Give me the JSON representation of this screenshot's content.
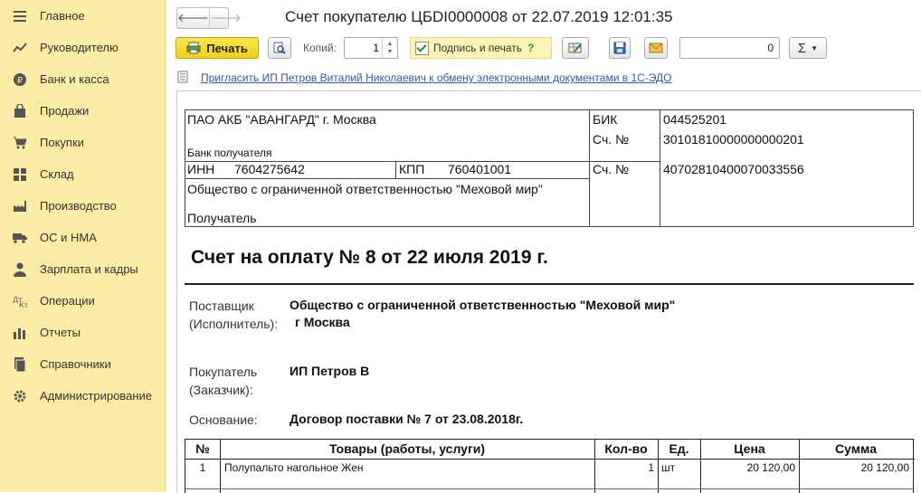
{
  "sidebar": {
    "items": [
      {
        "label": "Главное",
        "icon": "hamburger-icon"
      },
      {
        "label": "Руководителю",
        "icon": "chart-line-icon"
      },
      {
        "label": "Банк и касса",
        "icon": "ruble-icon"
      },
      {
        "label": "Продажи",
        "icon": "shopping-bag-icon"
      },
      {
        "label": "Покупки",
        "icon": "cart-icon"
      },
      {
        "label": "Склад",
        "icon": "warehouse-grid-icon"
      },
      {
        "label": "Производство",
        "icon": "factory-icon"
      },
      {
        "label": "ОС и НМА",
        "icon": "truck-icon"
      },
      {
        "label": "Зарплата и кадры",
        "icon": "person-icon"
      },
      {
        "label": "Операции",
        "icon": "debit-credit-icon"
      },
      {
        "label": "Отчеты",
        "icon": "bar-chart-icon"
      },
      {
        "label": "Справочники",
        "icon": "books-icon"
      },
      {
        "label": "Администрирование",
        "icon": "gear-icon"
      }
    ]
  },
  "header": {
    "back": "🡐",
    "forward": "🡒",
    "title": "Счет покупателю ЦБDI0000008 от 22.07.2019 12:01:35"
  },
  "toolbar": {
    "print_label": "Печать",
    "copies_label": "Копий:",
    "copies_value": "1",
    "sign_print_label": "Подпись и печать",
    "help": "?",
    "sum_value": "0",
    "sigma": "Σ"
  },
  "edo_link": "Пригласить ИП Петров Виталий Николаевич к обмену электронными документами в 1С-ЭДО",
  "bank": {
    "bank_name": "ПАО АКБ \"АВАНГАРД\" г. Москва",
    "bank_caption": "Банк получателя",
    "bik_label": "БИК",
    "bik_value": "044525201",
    "corr_label": "Сч. №",
    "corr_value": "30101810000000000201",
    "inn_label": "ИНН",
    "inn_value": "7604275642",
    "kpp_label": "КПП",
    "kpp_value": "760401001",
    "acc_label": "Сч. №",
    "acc_value": "40702810400070033556",
    "recipient_name": "Общество с ограниченной ответственностью \"Меховой мир\"",
    "recipient_caption": "Получатель"
  },
  "invoice": {
    "title": "Счет на оплату № 8 от 22 июля 2019 г.",
    "supplier_label_1": "Поставщик",
    "supplier_label_2": "(Исполнитель):",
    "supplier_value_1": "Общество с ограниченной ответственностью \"Меховой мир\"",
    "supplier_value_2": "г Москва",
    "buyer_label_1": "Покупатель",
    "buyer_label_2": "(Заказчик):",
    "buyer_value": "ИП Петров В",
    "basis_label": "Основание:",
    "basis_value": "Договор поставки № 7 от 23.08.2018г."
  },
  "table": {
    "headers": [
      "№",
      "Товары (работы, услуги)",
      "Кол-во",
      "Ед.",
      "Цена",
      "Сумма"
    ],
    "rows": [
      {
        "n": "1",
        "name": "Полупальто нагольное Жен",
        "qty": "1",
        "unit": "шт",
        "price": "20 120,00",
        "sum": "20 120,00"
      }
    ]
  }
}
